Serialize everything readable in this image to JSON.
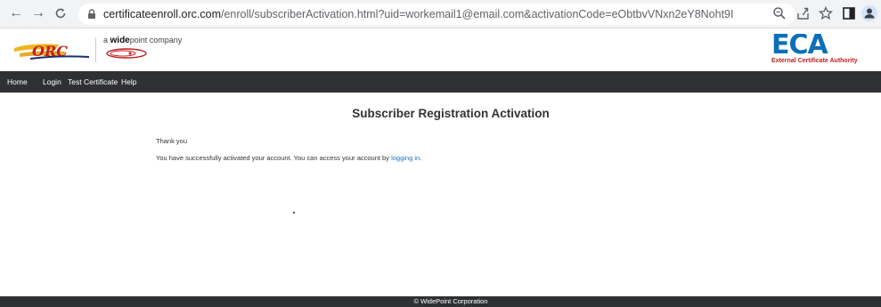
{
  "browser": {
    "url_host": "certificateenroll.orc.com",
    "url_rest": "/enroll/subscriberActivation.html?uid=workemail1@email.com&activationCode=eObtbvVNxn2eY8Noht9I"
  },
  "header": {
    "orc_logo": "ORC",
    "widepoint_prefix": "a ",
    "widepoint_bold": "wide",
    "widepoint_suffix": "point company",
    "eca_letters": "ECA",
    "eca_sub": "External Certificate Authority"
  },
  "nav": {
    "items": [
      "Home",
      "Login",
      "Test Certificate",
      "Help"
    ]
  },
  "main": {
    "title": "Subscriber Registration Activation",
    "thank_you": "Thank you",
    "message_before_link": "You have successfully activated your account. You can access your account by ",
    "link_text": "logging in",
    "message_after_link": "."
  },
  "footer": {
    "copyright": "© WidePoint Corporation"
  },
  "colors": {
    "nav_bg": "#2f3033",
    "eca_blue": "#0d6fb8",
    "eca_red": "#c0201f",
    "link": "#1a73c8"
  }
}
